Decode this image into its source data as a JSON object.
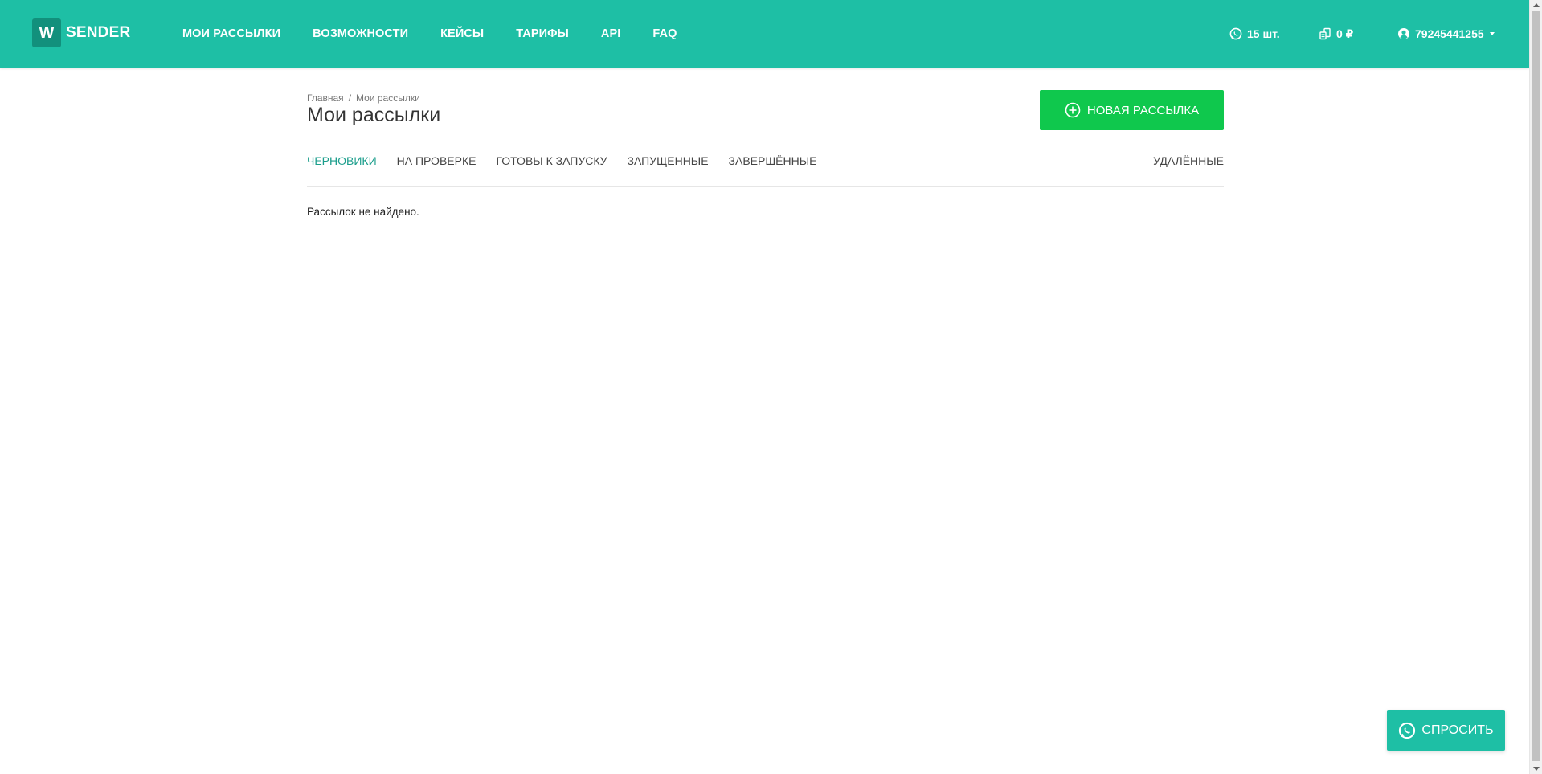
{
  "brand": {
    "logo_letter": "W",
    "name": "SENDER"
  },
  "nav": {
    "links": [
      "МОИ РАССЫЛКИ",
      "ВОЗМОЖНОСТИ",
      "КЕЙСЫ",
      "ТАРИФЫ",
      "API",
      "FAQ"
    ],
    "whatsapp_count": "15 шт.",
    "balance": "0 ₽",
    "user": "79245441255"
  },
  "breadcrumb": {
    "home": "Главная",
    "separator": "/",
    "current": "Мои рассылки"
  },
  "page": {
    "title": "Мои рассылки",
    "new_button": "НОВАЯ РАССЫЛКА",
    "empty_message": "Рассылок не найдено."
  },
  "tabs": {
    "items": [
      "ЧЕРНОВИКИ",
      "НА ПРОВЕРКЕ",
      "ГОТОВЫ К ЗАПУСКУ",
      "ЗАПУЩЕННЫЕ",
      "ЗАВЕРШЁННЫЕ"
    ],
    "deleted": "УДАЛЁННЫЕ",
    "active": "ЧЕРНОВИКИ"
  },
  "chat": {
    "ask_label": "СПРОСИТЬ"
  },
  "colors": {
    "primary": "#1ebfa5",
    "primary_dark": "#12907c",
    "button_green": "#0fc84d",
    "tab_active": "#1a9d8b"
  },
  "icons": [
    "whatsapp-icon",
    "coins-icon",
    "user-circle-icon",
    "plus-circle-icon",
    "caret-down-icon"
  ]
}
